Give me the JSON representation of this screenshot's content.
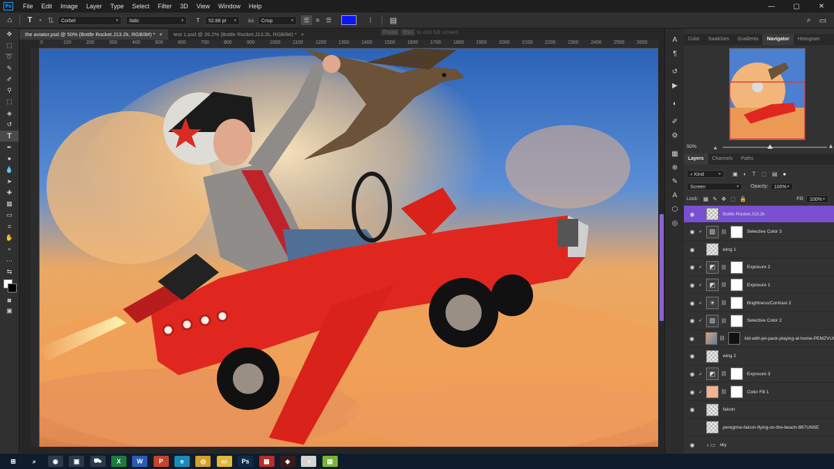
{
  "app": {
    "logo_text": "Ps"
  },
  "menu": [
    "File",
    "Edit",
    "Image",
    "Layer",
    "Type",
    "Select",
    "Filter",
    "3D",
    "View",
    "Window",
    "Help"
  ],
  "window_controls": [
    "—",
    "▢",
    "✕"
  ],
  "options_bar": {
    "font_family": "Corbel",
    "font_style": "Italic",
    "font_size": "52.88 pt",
    "antialias": "Crisp",
    "text_color": "#0b14ff"
  },
  "tabs": [
    {
      "label": "the aviator.psd @ 50% (Bottle Rocket.J13.2k, RGB/8#) *",
      "close": "×"
    },
    {
      "label": "test 1.psd @ 26.2% (Bottle Rocket.J13.2k, RGB/8#) *",
      "close": "×"
    }
  ],
  "fullscreen_hint": {
    "key1": "Press",
    "key2": "Esc",
    "text": "to exit full screen"
  },
  "ruler_labels": [
    "0",
    "100",
    "200",
    "300",
    "400",
    "500",
    "600",
    "700",
    "800",
    "900",
    "1000",
    "1100",
    "1200",
    "1300",
    "1400",
    "1500",
    "1600",
    "1700",
    "1800",
    "1900",
    "2000",
    "2100",
    "2200",
    "2300",
    "2400",
    "2500",
    "2600",
    "2700"
  ],
  "navigator": {
    "tabs": [
      "Color",
      "Swatches",
      "Gradients",
      "Navigator",
      "Histogram"
    ],
    "active_tab": "Navigator",
    "zoom": "50%"
  },
  "layers_panel": {
    "tabs": [
      "Layers",
      "Channels",
      "Paths"
    ],
    "active_tab": "Layers",
    "filter_kind": "Kind",
    "blend_mode": "Screen",
    "opacity_label": "Opacity:",
    "opacity": "100%",
    "lock_label": "Lock:",
    "fill_label": "Fill:",
    "fill": "100%",
    "layers": [
      {
        "name": "Bottle Rocket.J13.2k",
        "kind": "pixel",
        "selected": true,
        "clipped": false,
        "visible": true
      },
      {
        "name": "Selective Color 3",
        "kind": "adj",
        "icon": "▧",
        "clipped": true,
        "visible": true
      },
      {
        "name": "wing 1",
        "kind": "pixel",
        "clipped": false,
        "visible": true
      },
      {
        "name": "Exposure 2",
        "kind": "adj",
        "icon": "◩",
        "clipped": true,
        "visible": true
      },
      {
        "name": "Exposure 1",
        "kind": "adj",
        "icon": "◩",
        "clipped": true,
        "visible": true
      },
      {
        "name": "Brightness/Contrast 2",
        "kind": "adj",
        "icon": "☀",
        "clipped": true,
        "visible": true
      },
      {
        "name": "Selective Color 2",
        "kind": "adj",
        "icon": "▧",
        "clipped": true,
        "visible": true
      },
      {
        "name": "kid-with-jet-pack-playing-at-home-PEMZVUQ...",
        "kind": "photo",
        "clipped": false,
        "visible": true
      },
      {
        "name": "wing 2",
        "kind": "pixel",
        "clipped": false,
        "visible": true
      },
      {
        "name": "Exposure 3",
        "kind": "adj",
        "icon": "◩",
        "clipped": true,
        "visible": true
      },
      {
        "name": "Color Fill 1",
        "kind": "fill",
        "clipped": true,
        "visible": true
      },
      {
        "name": "falcon",
        "kind": "pixel",
        "clipped": false,
        "visible": true
      },
      {
        "name": "peregrine-falcon-flying-on-the-beach-8B7UNSE",
        "kind": "pixel",
        "clipped": false,
        "visible": false
      },
      {
        "name": "sky",
        "kind": "group",
        "clipped": false,
        "visible": true
      }
    ]
  },
  "taskbar": {
    "apps": [
      {
        "name": "windows-start",
        "label": "⊞",
        "color": "#101c2b"
      },
      {
        "name": "search",
        "label": "⌕",
        "color": "#101c2b"
      },
      {
        "name": "app-1",
        "label": "◉",
        "color": "#2a3a4a"
      },
      {
        "name": "app-2",
        "label": "▣",
        "color": "#2a3a4a"
      },
      {
        "name": "store",
        "label": "⛟",
        "color": "#2a3a4a"
      },
      {
        "name": "excel",
        "label": "X",
        "color": "#1f7a3f"
      },
      {
        "name": "word",
        "label": "W",
        "color": "#2b5bb5"
      },
      {
        "name": "powerpoint",
        "label": "P",
        "color": "#c4432b"
      },
      {
        "name": "edge",
        "label": "e",
        "color": "#1a8bb8"
      },
      {
        "name": "chrome",
        "label": "◎",
        "color": "#d2a12a"
      },
      {
        "name": "explorer",
        "label": "▭",
        "color": "#e0b93a"
      },
      {
        "name": "photoshop",
        "label": "Ps",
        "color": "#0d2a4a"
      },
      {
        "name": "app-3",
        "label": "▦",
        "color": "#b52d2d"
      },
      {
        "name": "app-4",
        "label": "◆",
        "color": "#3a1a1a"
      },
      {
        "name": "app-5",
        "label": "◑",
        "color": "#d4d4d4"
      },
      {
        "name": "app-6",
        "label": "▤",
        "color": "#7ab33a"
      }
    ]
  }
}
